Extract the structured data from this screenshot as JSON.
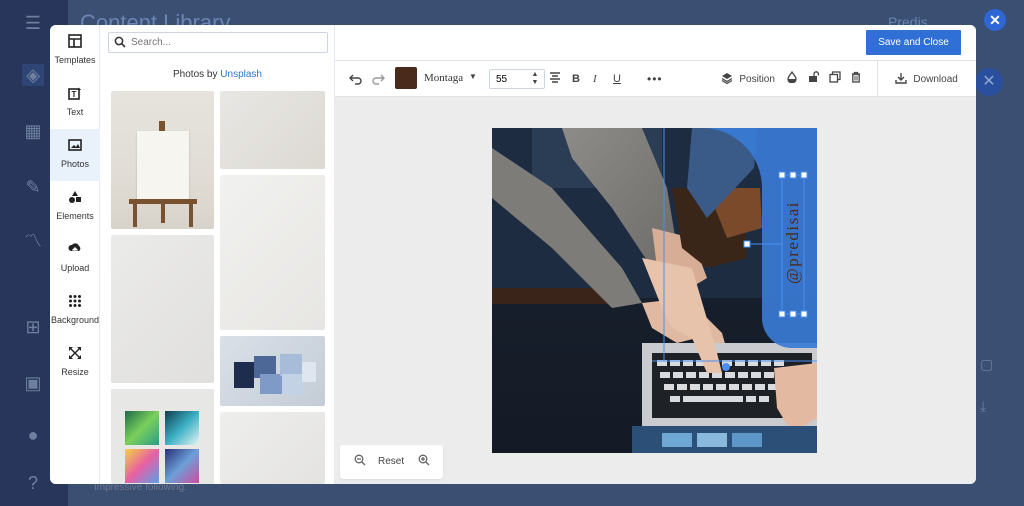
{
  "background_app": {
    "title": "Content Library",
    "user": "Predis",
    "footer_text": "Impressive following."
  },
  "rail": {
    "items": [
      {
        "label": "Templates",
        "icon": "templates-icon"
      },
      {
        "label": "Text",
        "icon": "text-icon"
      },
      {
        "label": "Photos",
        "icon": "photos-icon"
      },
      {
        "label": "Elements",
        "icon": "elements-icon"
      },
      {
        "label": "Upload",
        "icon": "upload-icon"
      },
      {
        "label": "Background",
        "icon": "background-icon"
      },
      {
        "label": "Resize",
        "icon": "resize-icon"
      }
    ],
    "active": "Photos"
  },
  "panel": {
    "search_placeholder": "Search...",
    "photos_by_prefix": "Photos by ",
    "photos_by_link": "Unsplash"
  },
  "header": {
    "save_label": "Save and Close"
  },
  "toolbar": {
    "font_color": "#4a2a1b",
    "font_name": "Montaga",
    "font_size": "55",
    "position_label": "Position",
    "download_label": "Download"
  },
  "canvas": {
    "text": "@predisai",
    "accent": "#3a7bd5"
  },
  "zoom": {
    "reset_label": "Reset"
  },
  "colors": {
    "primary": "#2f6fd6",
    "link": "#2f74c8"
  }
}
